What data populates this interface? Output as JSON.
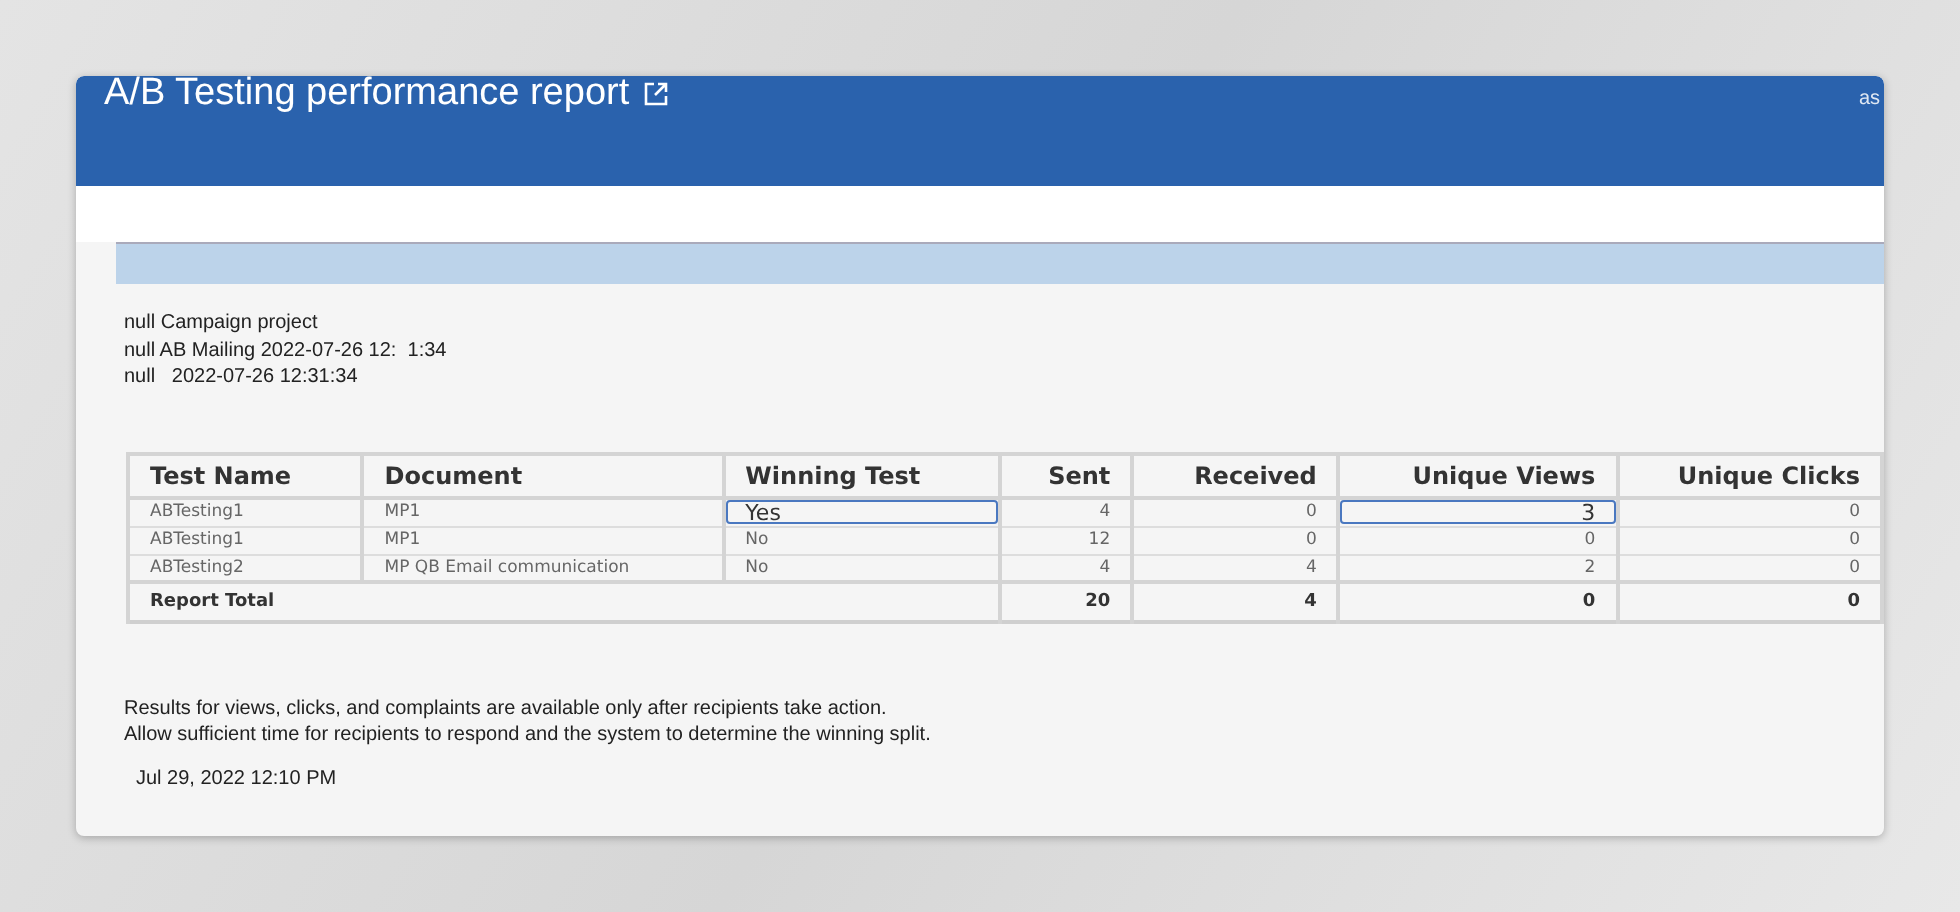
{
  "header": {
    "title": "A/B Testing performance report",
    "user": "as"
  },
  "info_lines": [
    "null Campaign project",
    "null AB Mailing 2022-07-26 12:  1:34",
    "null   2022-07-26 12:31:34"
  ],
  "table": {
    "columns": [
      "Test Name",
      "Document",
      "Winning Test",
      "Sent",
      "Received",
      "Unique Views",
      "Unique Clicks"
    ],
    "rows": [
      {
        "cells": [
          {
            "text": "ABTesting1",
            "highlighted": false
          },
          {
            "text": "MP1",
            "highlighted": false
          },
          {
            "text": "Yes",
            "highlighted": true
          },
          {
            "text": "4",
            "highlighted": false
          },
          {
            "text": "0",
            "highlighted": false
          },
          {
            "text": "3",
            "highlighted": true
          },
          {
            "text": "0",
            "highlighted": false
          }
        ]
      },
      {
        "cells": [
          {
            "text": "ABTesting1",
            "highlighted": false
          },
          {
            "text": "MP1",
            "highlighted": false
          },
          {
            "text": "No",
            "highlighted": false
          },
          {
            "text": "12",
            "highlighted": false
          },
          {
            "text": "0",
            "highlighted": false
          },
          {
            "text": "0",
            "highlighted": false
          },
          {
            "text": "0",
            "highlighted": false
          }
        ]
      },
      {
        "cells": [
          {
            "text": "ABTesting2",
            "highlighted": false
          },
          {
            "text": "MP QB Email communication",
            "highlighted": false
          },
          {
            "text": "No",
            "highlighted": false
          },
          {
            "text": "4",
            "highlighted": false
          },
          {
            "text": "4",
            "highlighted": false
          },
          {
            "text": "2",
            "highlighted": false
          },
          {
            "text": "0",
            "highlighted": false
          }
        ]
      }
    ],
    "total": {
      "label": "Report Total",
      "cells": [
        "20",
        "4",
        "0",
        "0"
      ]
    }
  },
  "notes": [
    "Results for views, clicks, and complaints are available only after recipients take action.",
    "Allow sufficient time for recipients to respond and the system to determine the winning split."
  ],
  "timestamp": "Jul 29, 2022 12:10 PM"
}
